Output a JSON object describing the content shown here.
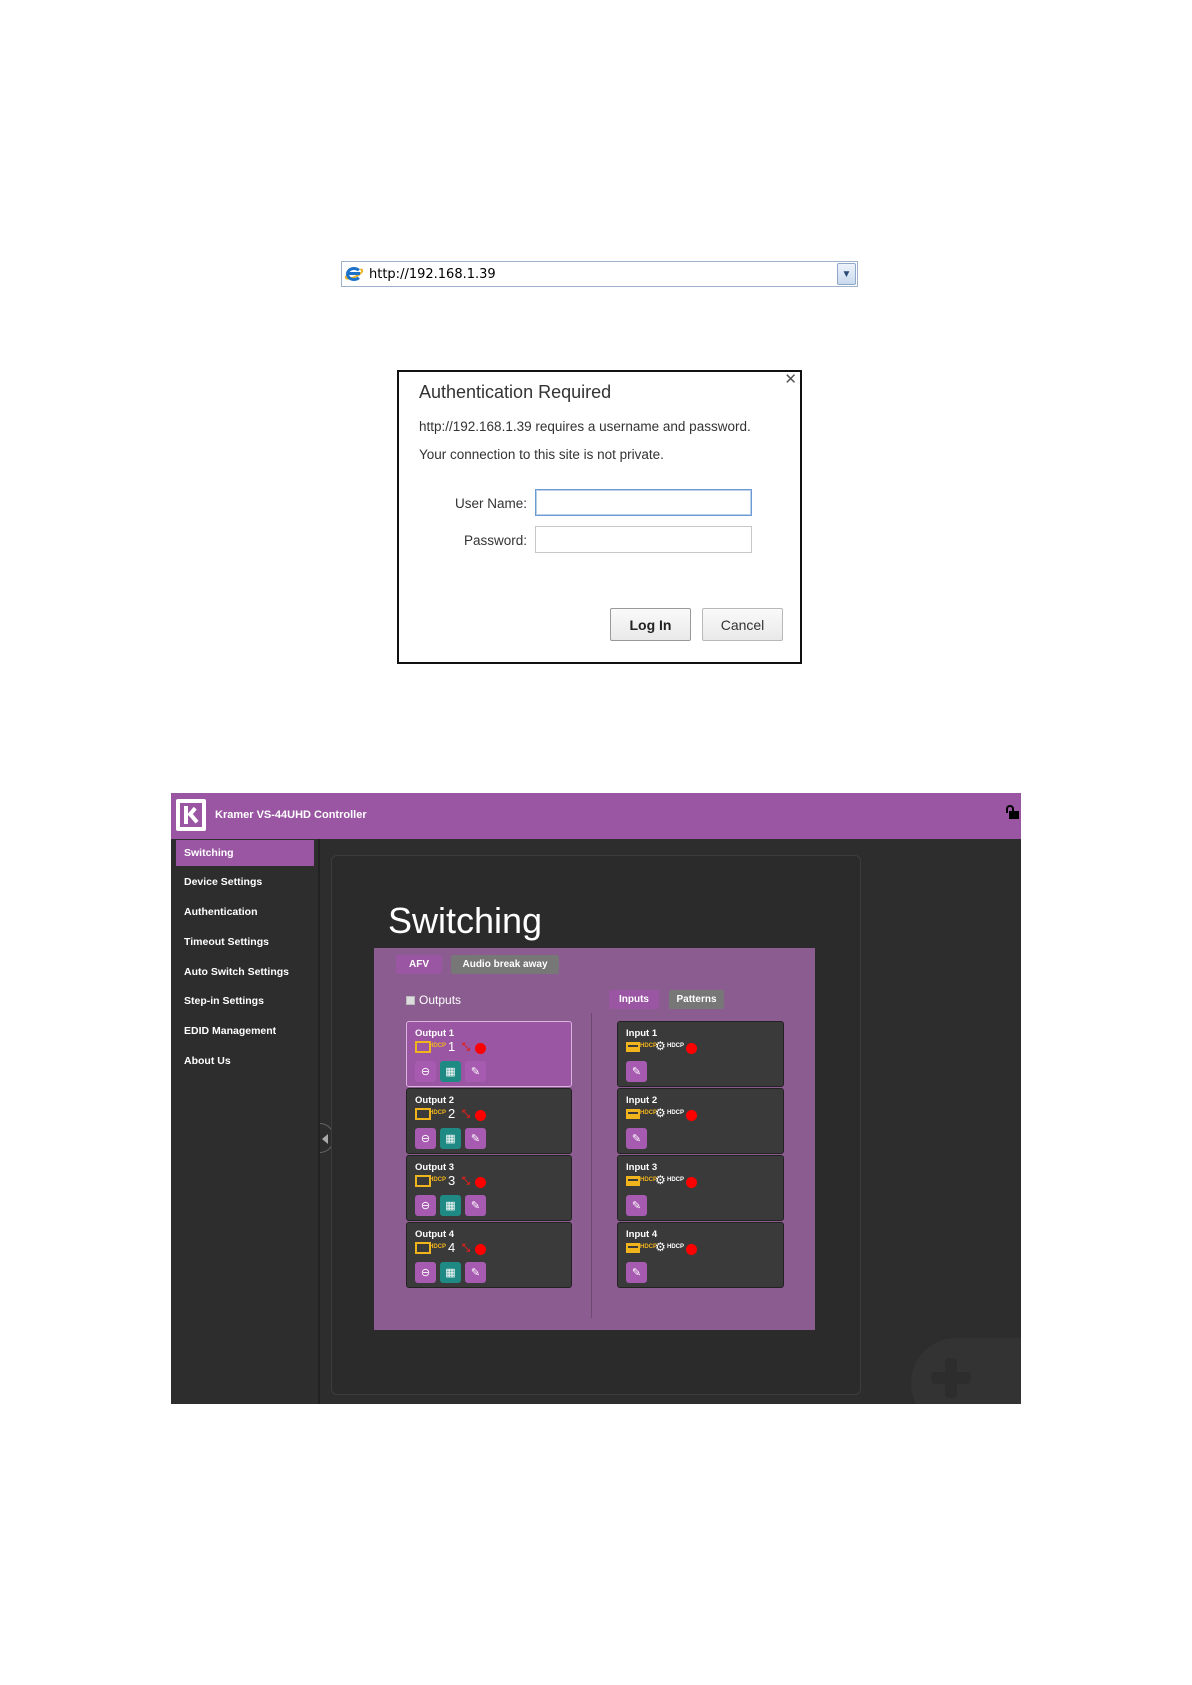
{
  "address_bar": {
    "url": "http://192.168.1.39",
    "browser_icon": "ie-icon",
    "dropdown_icon": "chevron-down-icon"
  },
  "auth_dialog": {
    "title": "Authentication Required",
    "message1": "http://192.168.1.39 requires a username and password.",
    "message2": "Your connection to this site is not private.",
    "username_label": "User Name:",
    "password_label": "Password:",
    "username_value": "",
    "password_value": "",
    "login_label": "Log In",
    "cancel_label": "Cancel",
    "close_glyph": "✕"
  },
  "app": {
    "title": "Kramer VS-44UHD Controller",
    "brand_color": "#9b56a3",
    "nav": [
      {
        "label": "Switching",
        "active": true
      },
      {
        "label": "Device Settings"
      },
      {
        "label": "Authentication"
      },
      {
        "label": "Timeout Settings"
      },
      {
        "label": "Auto Switch Settings"
      },
      {
        "label": "Step-in Settings"
      },
      {
        "label": "EDID Management"
      },
      {
        "label": "About Us"
      }
    ],
    "page_title": "Switching",
    "tabs": {
      "afv": "AFV",
      "audio_breakaway": "Audio break away"
    },
    "outputs_label": "Outputs",
    "io_tabs": {
      "inputs": "Inputs",
      "patterns": "Patterns"
    },
    "hdcp_label": "HDCP",
    "outputs": [
      {
        "name": "Output 1",
        "number": "1",
        "selected": true
      },
      {
        "name": "Output 2",
        "number": "2"
      },
      {
        "name": "Output 3",
        "number": "3"
      },
      {
        "name": "Output 4",
        "number": "4"
      }
    ],
    "inputs": [
      {
        "name": "Input 1"
      },
      {
        "name": "Input 2"
      },
      {
        "name": "Input 3"
      },
      {
        "name": "Input 4"
      }
    ]
  }
}
